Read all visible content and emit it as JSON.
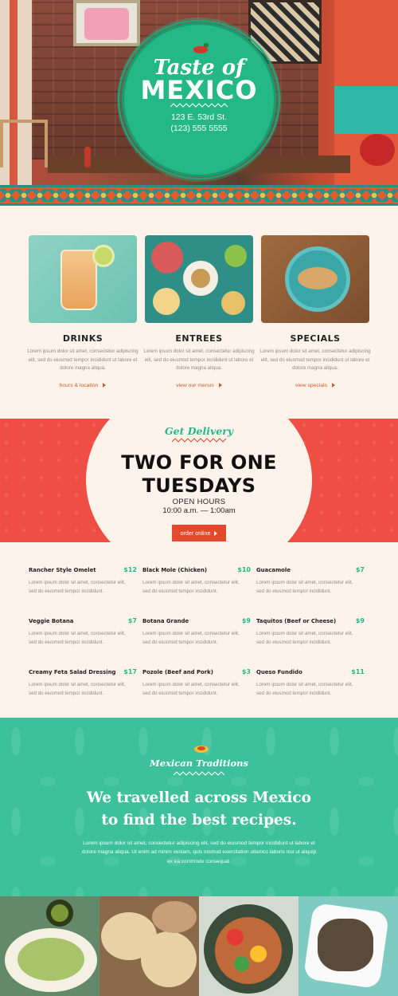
{
  "hero": {
    "logo_script": "Taste of",
    "logo_title": "MEXICO",
    "address": "123 E. 53rd St.",
    "phone": "(123) 555 5555",
    "icon": "chili-pepper-icon",
    "colors": {
      "logo_green": "#24b886",
      "accent_orange": "#e85a2c",
      "accent_teal": "#2c8f86"
    }
  },
  "features": [
    {
      "title": "DRINKS",
      "text": "Lorem ipsum dolor sit amet, consectetur adipiscing elit, sed do eiusmod tempor incididunt ut labore et dolore magna aliqua.",
      "link": "hours & location"
    },
    {
      "title": "ENTREES",
      "text": "Lorem ipsum dolor sit amet, consectetur adipiscing elit, sed do eiusmod tempor incididunt ut labore et dolore magna aliqua.",
      "link": "view our menus"
    },
    {
      "title": "SPECIALS",
      "text": "Lorem ipsum dolor sit amet, consectetur adipiscing elit, sed do eiusmod tempor incididunt ut labore et dolore magna aliqua.",
      "link": "view specials"
    }
  ],
  "promo": {
    "script": "Get Delivery",
    "heading_line1": "TWO FOR ONE",
    "heading_line2": "TUESDAYS",
    "hours_label": "OPEN HOURS",
    "hours": "10:00 a.m. — 1:00am",
    "button": "order online",
    "colors": {
      "band_red": "#ee4e44",
      "button": "#e24a2b"
    }
  },
  "menu": {
    "description": "Lorem ipsum dolor sit amet, consectetur elit, sed do eiusmod tempor incididunt.",
    "items": [
      {
        "name": "Rancher Style Omelet",
        "price": "$12"
      },
      {
        "name": "Black Mole (Chicken)",
        "price": "$10"
      },
      {
        "name": "Guacamole",
        "price": "$7"
      },
      {
        "name": "Veggie Botana",
        "price": "$7"
      },
      {
        "name": "Botana Grande",
        "price": "$9"
      },
      {
        "name": "Taquitos (Beef or Cheese)",
        "price": "$9"
      },
      {
        "name": "Creamy Feta Salad Dressing",
        "price": "$17"
      },
      {
        "name": "Pozole (Beef and Pork)",
        "price": "$3"
      },
      {
        "name": "Queso Fundido",
        "price": "$11"
      }
    ],
    "colors": {
      "price": "#24b886"
    }
  },
  "traditions": {
    "script": "Mexican Traditions",
    "heading_line1": "We travelled across Mexico",
    "heading_line2": "to find the best recipes.",
    "body": "Lorem ipsum dolor sit amet, consectetur adipiscing elit, sed do eiusmod tempor incididunt ut labore et dolore magna aliqua. Ut enim ad minim veniam, quis nostrud exercitation ullamco laboris nisi ut aliquip ex ea commodo consequat.",
    "colors": {
      "band_green": "#3cc19a"
    }
  }
}
